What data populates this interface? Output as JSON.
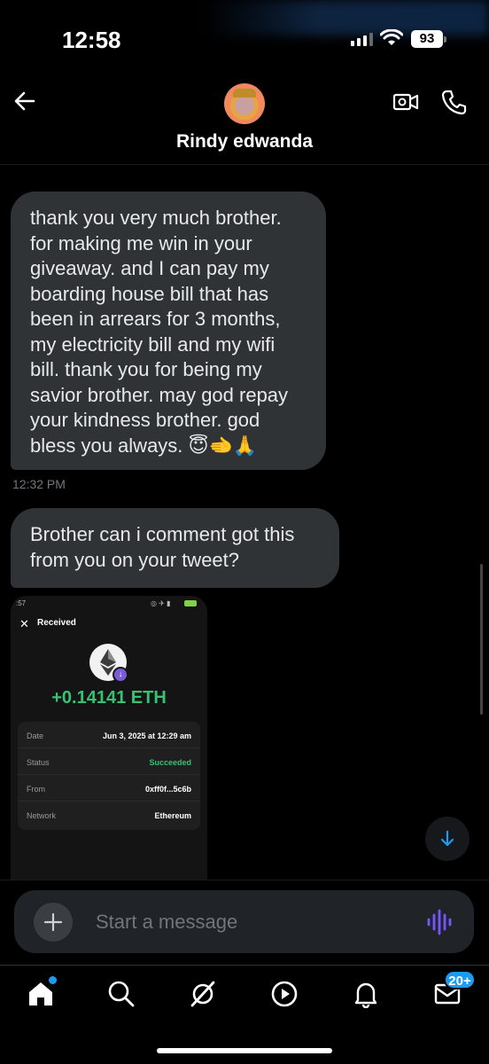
{
  "status_bar": {
    "time": "12:58",
    "battery": "93"
  },
  "header": {
    "contact_name": "Rindy edwanda"
  },
  "messages": [
    {
      "text": "thank you very much brother. for making me win in your giveaway. and I can pay my boarding house bill that has been in arrears for 3 months, my electricity bill and my wifi bill. thank you for being my savior brother. may god repay your kindness brother. god bless you always.",
      "emoji": "😇🫲🙏",
      "time": "12:32 PM"
    },
    {
      "text": "Brother can i comment got this from you on your tweet?"
    }
  ],
  "attachment": {
    "status_time": ":57",
    "title": "Received",
    "amount": "+0.14141 ETH",
    "details": [
      {
        "label": "Date",
        "value": "Jun 3, 2025 at 12:29 am"
      },
      {
        "label": "Status",
        "value": "Succeeded"
      },
      {
        "label": "From",
        "value": "0xff0f...5c6b"
      },
      {
        "label": "Network",
        "value": "Ethereum"
      }
    ]
  },
  "composer": {
    "placeholder": "Start a message"
  },
  "bottom_nav": {
    "dm_badge": "20+"
  },
  "colors": {
    "accent": "#1d9bf0",
    "bubble": "#2f3336",
    "success": "#38c172"
  }
}
